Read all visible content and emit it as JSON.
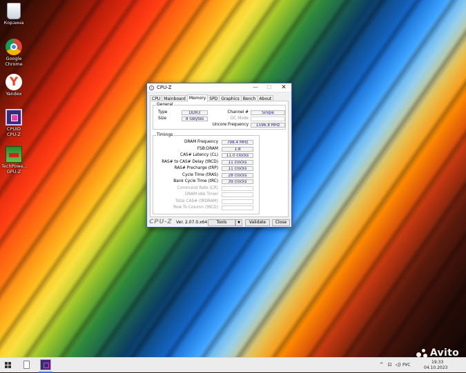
{
  "desktop": {
    "icons": [
      {
        "label": "Корзина",
        "icon": "recycle-bin-icon"
      },
      {
        "label": "Google Chrome",
        "icon": "chrome-icon"
      },
      {
        "label": "Yandex",
        "icon": "yandex-icon"
      },
      {
        "label": "CPUID CPU-Z",
        "icon": "cpuz-icon"
      },
      {
        "label": "TechPowe... GPU-Z",
        "icon": "gpuz-icon"
      }
    ],
    "yandex_glyph": "Y"
  },
  "window": {
    "title": "CPU-Z",
    "controls": {
      "minimize": "—",
      "maximize": "☐",
      "close": "✕"
    },
    "tabs": [
      "CPU",
      "Mainboard",
      "Memory",
      "SPD",
      "Graphics",
      "Bench",
      "About"
    ],
    "active_tab": "Memory",
    "general": {
      "label": "General",
      "type_label": "Type",
      "type_value": "DDR3",
      "size_label": "Size",
      "size_value": "8 GBytes",
      "channel_label": "Channel #",
      "channel_value": "Single",
      "dc_mode_label": "DC Mode",
      "dc_mode_value": "",
      "uncore_label": "Uncore Frequency",
      "uncore_value": "1596.8 MHz"
    },
    "timings": {
      "label": "Timings",
      "rows": [
        {
          "label": "DRAM Frequency",
          "value": "798.4 MHz",
          "enabled": true
        },
        {
          "label": "FSB:DRAM",
          "value": "1:8",
          "enabled": true
        },
        {
          "label": "CAS# Latency (CL)",
          "value": "11.0 clocks",
          "enabled": true
        },
        {
          "label": "RAS# to CAS# Delay (tRCD)",
          "value": "11 clocks",
          "enabled": true
        },
        {
          "label": "RAS# Precharge (tRP)",
          "value": "11 clocks",
          "enabled": true
        },
        {
          "label": "Cycle Time (tRAS)",
          "value": "28 clocks",
          "enabled": true
        },
        {
          "label": "Bank Cycle Time (tRC)",
          "value": "39 clocks",
          "enabled": true
        },
        {
          "label": "Command Rate (CR)",
          "value": "",
          "enabled": false
        },
        {
          "label": "DRAM Idle Timer",
          "value": "",
          "enabled": false
        },
        {
          "label": "Total CAS# (tRDRAM)",
          "value": "",
          "enabled": false
        },
        {
          "label": "Row To Column (tRCD)",
          "value": "",
          "enabled": false
        }
      ]
    },
    "footer": {
      "brand": "CPU-Z",
      "version": "Ver. 2.07.0.x64",
      "tools_label": "Tools",
      "tools_arrow": "▼",
      "validate_label": "Validate",
      "close_label": "Close"
    }
  },
  "taskbar": {
    "tray_chevron": "^",
    "tray_network": "⊡",
    "tray_volume": "◁)",
    "language": "РУС",
    "time": "19:33",
    "date": "04.10.2023"
  },
  "watermark": "Avito"
}
